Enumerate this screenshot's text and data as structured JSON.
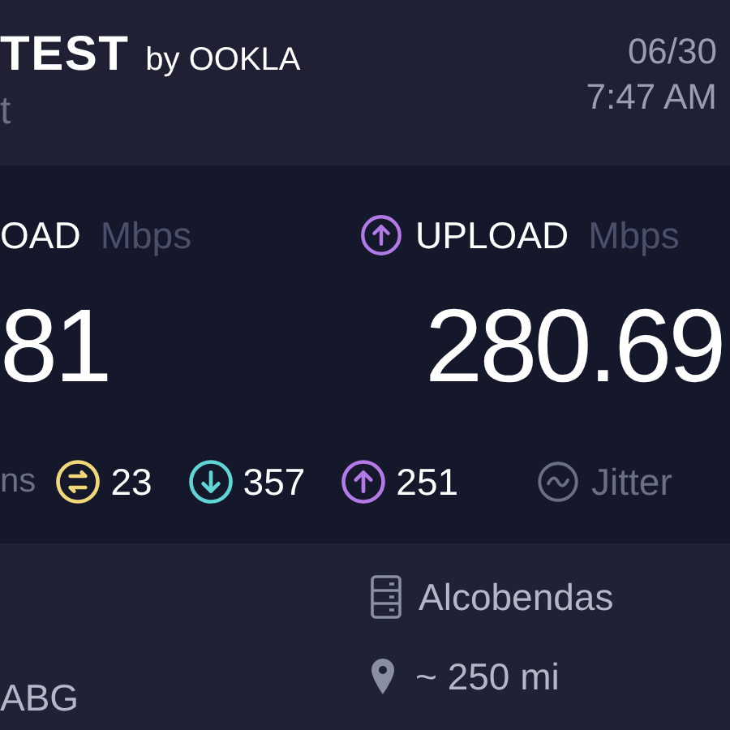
{
  "header": {
    "logo_text": "TEST",
    "logo_byline": "by OOKLA",
    "subtitle": "t",
    "date": "06/30",
    "time": "7:47 AM"
  },
  "results": [
    {
      "kind": "download",
      "label": "OAD",
      "unit": "Mbps",
      "value": "81"
    },
    {
      "kind": "upload",
      "label": "UPLOAD",
      "unit": "Mbps",
      "value": "280.69"
    }
  ],
  "ping": {
    "unit": "ns",
    "stats": [
      {
        "kind": "idle",
        "value": "23"
      },
      {
        "kind": "download",
        "value": "357"
      },
      {
        "kind": "upload",
        "value": "251"
      }
    ]
  },
  "jitter": {
    "label": "Jitter"
  },
  "provider": {
    "name": "ABG"
  },
  "server": {
    "name": "Alcobendas",
    "distance": "~ 250 mi"
  }
}
